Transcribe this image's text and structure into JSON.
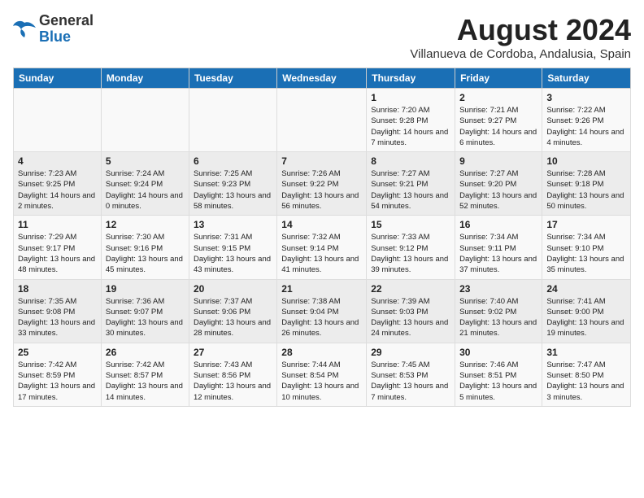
{
  "header": {
    "logo": {
      "general": "General",
      "blue": "Blue"
    },
    "title": "August 2024",
    "subtitle": "Villanueva de Cordoba, Andalusia, Spain"
  },
  "days_of_week": [
    "Sunday",
    "Monday",
    "Tuesday",
    "Wednesday",
    "Thursday",
    "Friday",
    "Saturday"
  ],
  "weeks": [
    [
      {
        "day": "",
        "info": ""
      },
      {
        "day": "",
        "info": ""
      },
      {
        "day": "",
        "info": ""
      },
      {
        "day": "",
        "info": ""
      },
      {
        "day": "1",
        "info": "Sunrise: 7:20 AM\nSunset: 9:28 PM\nDaylight: 14 hours and 7 minutes."
      },
      {
        "day": "2",
        "info": "Sunrise: 7:21 AM\nSunset: 9:27 PM\nDaylight: 14 hours and 6 minutes."
      },
      {
        "day": "3",
        "info": "Sunrise: 7:22 AM\nSunset: 9:26 PM\nDaylight: 14 hours and 4 minutes."
      }
    ],
    [
      {
        "day": "4",
        "info": "Sunrise: 7:23 AM\nSunset: 9:25 PM\nDaylight: 14 hours and 2 minutes."
      },
      {
        "day": "5",
        "info": "Sunrise: 7:24 AM\nSunset: 9:24 PM\nDaylight: 14 hours and 0 minutes."
      },
      {
        "day": "6",
        "info": "Sunrise: 7:25 AM\nSunset: 9:23 PM\nDaylight: 13 hours and 58 minutes."
      },
      {
        "day": "7",
        "info": "Sunrise: 7:26 AM\nSunset: 9:22 PM\nDaylight: 13 hours and 56 minutes."
      },
      {
        "day": "8",
        "info": "Sunrise: 7:27 AM\nSunset: 9:21 PM\nDaylight: 13 hours and 54 minutes."
      },
      {
        "day": "9",
        "info": "Sunrise: 7:27 AM\nSunset: 9:20 PM\nDaylight: 13 hours and 52 minutes."
      },
      {
        "day": "10",
        "info": "Sunrise: 7:28 AM\nSunset: 9:18 PM\nDaylight: 13 hours and 50 minutes."
      }
    ],
    [
      {
        "day": "11",
        "info": "Sunrise: 7:29 AM\nSunset: 9:17 PM\nDaylight: 13 hours and 48 minutes."
      },
      {
        "day": "12",
        "info": "Sunrise: 7:30 AM\nSunset: 9:16 PM\nDaylight: 13 hours and 45 minutes."
      },
      {
        "day": "13",
        "info": "Sunrise: 7:31 AM\nSunset: 9:15 PM\nDaylight: 13 hours and 43 minutes."
      },
      {
        "day": "14",
        "info": "Sunrise: 7:32 AM\nSunset: 9:14 PM\nDaylight: 13 hours and 41 minutes."
      },
      {
        "day": "15",
        "info": "Sunrise: 7:33 AM\nSunset: 9:12 PM\nDaylight: 13 hours and 39 minutes."
      },
      {
        "day": "16",
        "info": "Sunrise: 7:34 AM\nSunset: 9:11 PM\nDaylight: 13 hours and 37 minutes."
      },
      {
        "day": "17",
        "info": "Sunrise: 7:34 AM\nSunset: 9:10 PM\nDaylight: 13 hours and 35 minutes."
      }
    ],
    [
      {
        "day": "18",
        "info": "Sunrise: 7:35 AM\nSunset: 9:08 PM\nDaylight: 13 hours and 33 minutes."
      },
      {
        "day": "19",
        "info": "Sunrise: 7:36 AM\nSunset: 9:07 PM\nDaylight: 13 hours and 30 minutes."
      },
      {
        "day": "20",
        "info": "Sunrise: 7:37 AM\nSunset: 9:06 PM\nDaylight: 13 hours and 28 minutes."
      },
      {
        "day": "21",
        "info": "Sunrise: 7:38 AM\nSunset: 9:04 PM\nDaylight: 13 hours and 26 minutes."
      },
      {
        "day": "22",
        "info": "Sunrise: 7:39 AM\nSunset: 9:03 PM\nDaylight: 13 hours and 24 minutes."
      },
      {
        "day": "23",
        "info": "Sunrise: 7:40 AM\nSunset: 9:02 PM\nDaylight: 13 hours and 21 minutes."
      },
      {
        "day": "24",
        "info": "Sunrise: 7:41 AM\nSunset: 9:00 PM\nDaylight: 13 hours and 19 minutes."
      }
    ],
    [
      {
        "day": "25",
        "info": "Sunrise: 7:42 AM\nSunset: 8:59 PM\nDaylight: 13 hours and 17 minutes."
      },
      {
        "day": "26",
        "info": "Sunrise: 7:42 AM\nSunset: 8:57 PM\nDaylight: 13 hours and 14 minutes."
      },
      {
        "day": "27",
        "info": "Sunrise: 7:43 AM\nSunset: 8:56 PM\nDaylight: 13 hours and 12 minutes."
      },
      {
        "day": "28",
        "info": "Sunrise: 7:44 AM\nSunset: 8:54 PM\nDaylight: 13 hours and 10 minutes."
      },
      {
        "day": "29",
        "info": "Sunrise: 7:45 AM\nSunset: 8:53 PM\nDaylight: 13 hours and 7 minutes."
      },
      {
        "day": "30",
        "info": "Sunrise: 7:46 AM\nSunset: 8:51 PM\nDaylight: 13 hours and 5 minutes."
      },
      {
        "day": "31",
        "info": "Sunrise: 7:47 AM\nSunset: 8:50 PM\nDaylight: 13 hours and 3 minutes."
      }
    ]
  ]
}
